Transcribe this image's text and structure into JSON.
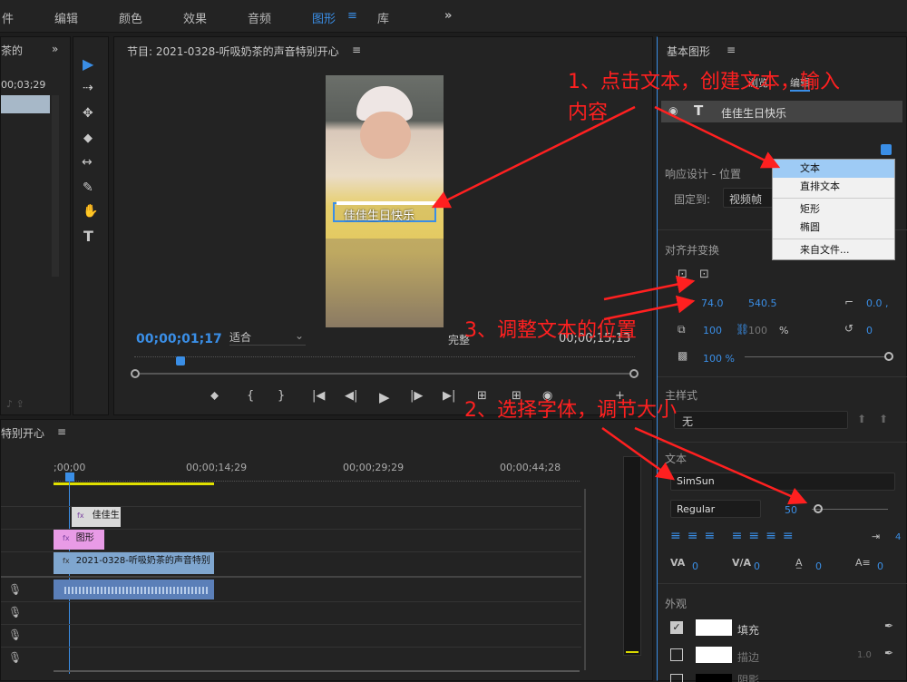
{
  "topbar": {
    "tabs": [
      "件",
      "编辑",
      "颜色",
      "效果",
      "音频",
      "图形",
      "库"
    ],
    "more": "»",
    "menu_glyph": "≡"
  },
  "left_panel": {
    "title": "茶的",
    "timecode": "00;03;29",
    "more": "»"
  },
  "tools": [
    "▶",
    "⇢",
    "✥",
    "◆",
    "↔",
    "✎",
    "✋",
    "T"
  ],
  "program": {
    "title": "节目: 2021-0328-听吸奶茶的声音特别开心",
    "menu_glyph": "≡",
    "overlay_text": "佳佳生日快乐",
    "timecode": "00;00;01;17",
    "fit": "适合",
    "quality": "完整",
    "duration": "00;00;15;13",
    "controls": [
      "⬥",
      "{",
      "}",
      "|◀",
      "◀|",
      "▶",
      "|▶",
      "▶|",
      "⊞",
      "⊞",
      "◉",
      "+"
    ]
  },
  "timeline": {
    "title": "特别开心",
    "menu_glyph": "≡",
    "ruler": [
      ";00;00",
      "00;00;14;29",
      "00;00;29;29",
      "00;00;44;28"
    ],
    "clips": {
      "title1": "佳佳生",
      "graphic": "图形",
      "video": "2021-0328-听吸奶茶的声音特别"
    },
    "fx": "fx"
  },
  "essential": {
    "title": "基本图形",
    "menu_glyph": "≡",
    "tabs": {
      "browse": "浏览",
      "edit": "编辑"
    },
    "layer_name": "佳佳生日快乐",
    "responsive_label": "响应设计 - 位置",
    "pin_label": "固定到:",
    "pin_value": "视频帧",
    "align_label": "对齐并变换",
    "pos_x": "74.0",
    "pos_y": "540.5",
    "anchor": "0.0 ,",
    "scale": "100",
    "scale2": "100",
    "percent": "%",
    "rotate": "0",
    "opacity": "100 %",
    "master_style_label": "主样式",
    "master_style_value": "无",
    "text_label": "文本",
    "font": "SimSun",
    "font_style": "Regular",
    "font_size": "50",
    "tracking": "0",
    "kerning": "0",
    "leading": "0",
    "baseline": "0",
    "tab_num": "4",
    "appearance_label": "外观",
    "fill_label": "填充",
    "stroke_label": "描边",
    "stroke_val": "1.0",
    "shadow_label": "阴影"
  },
  "menu": {
    "items": [
      "文本",
      "直排文本",
      "矩形",
      "椭圆",
      "来自文件..."
    ]
  },
  "annotations": {
    "step1": "1、点击文本，创建文本，输入",
    "step1b": "内容",
    "step2": "2、选择字体，调节大小",
    "step3": "3、调整文本的位置"
  },
  "colors": {
    "accent": "#3a8ee6",
    "annotation": "#ff2020",
    "graphic_clip": "#e89be6",
    "video_clip": "#7fa6cf",
    "audio_clip": "#6a8fc6"
  }
}
